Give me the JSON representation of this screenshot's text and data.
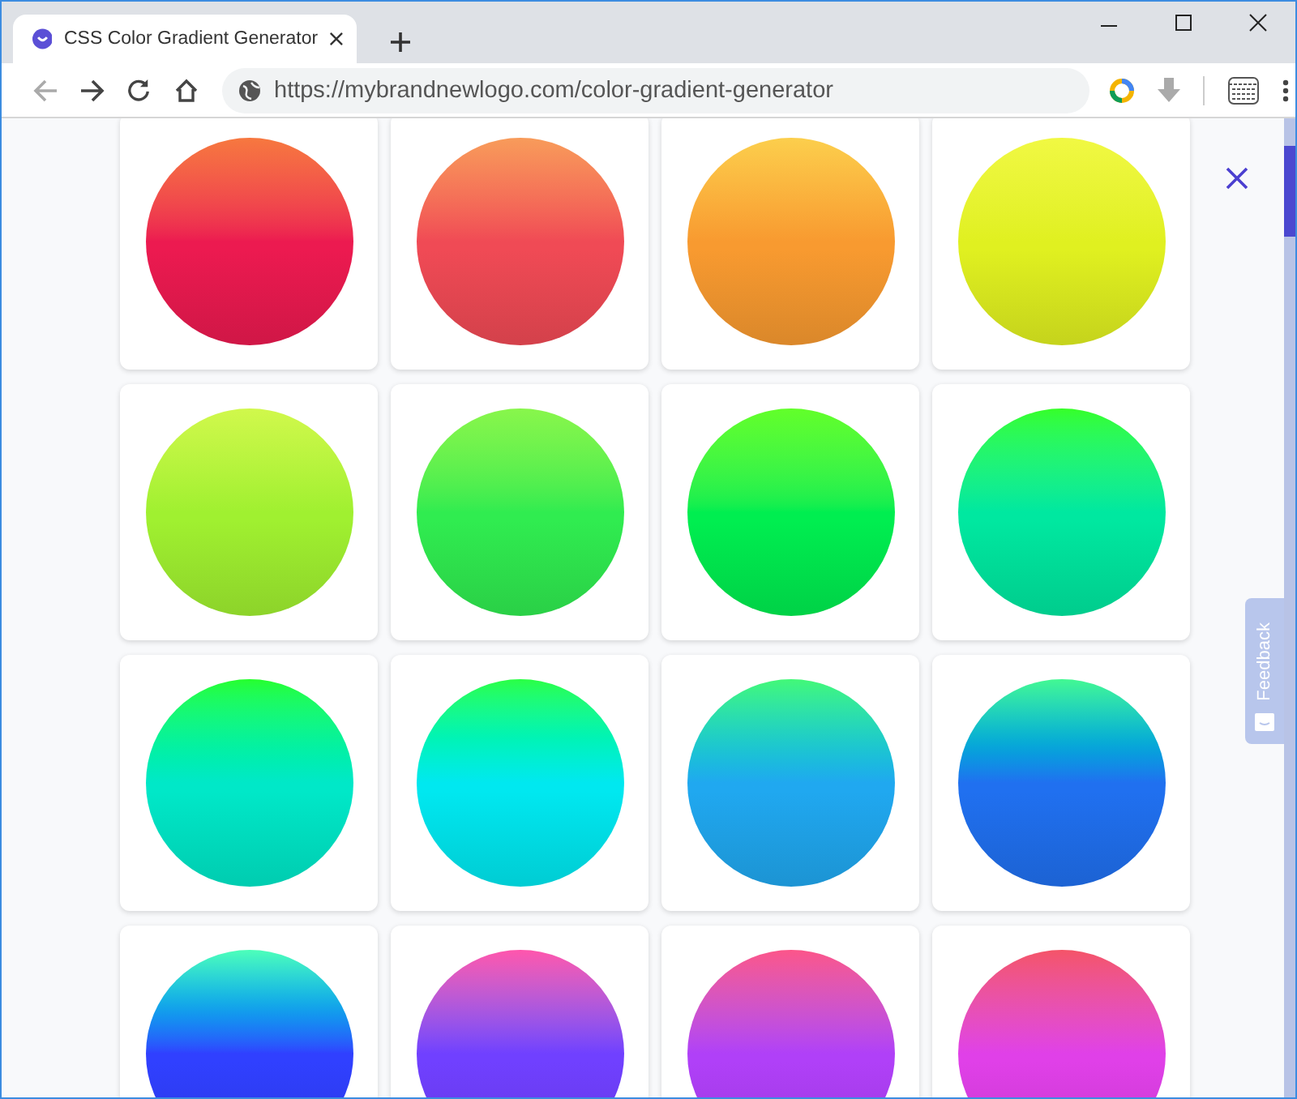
{
  "tab": {
    "title": "CSS Color Gradient Generator",
    "selected": true
  },
  "address_bar": {
    "url": "https://mybrandnewlogo.com/color-gradient-generator"
  },
  "circles": [
    {
      "color": "#ec1a50"
    },
    {
      "color": "#f04a55"
    },
    {
      "color": "#f89a30"
    },
    {
      "color": "#e0f020"
    },
    {
      "color": "#a0f030"
    },
    {
      "color": "#30ec50"
    },
    {
      "color": "#00ee50"
    },
    {
      "color": "#00e8a0"
    },
    {
      "color": "#00e8c8"
    },
    {
      "color": "#00e8f0"
    },
    {
      "color": "#20a8f0"
    },
    {
      "color": "#2070f0"
    },
    {
      "color": "#3040ff"
    },
    {
      "color": "#7040ff"
    },
    {
      "color": "#b040f8"
    },
    {
      "color": "#e040e8"
    }
  ],
  "feedback": {
    "label": "Feedback"
  }
}
